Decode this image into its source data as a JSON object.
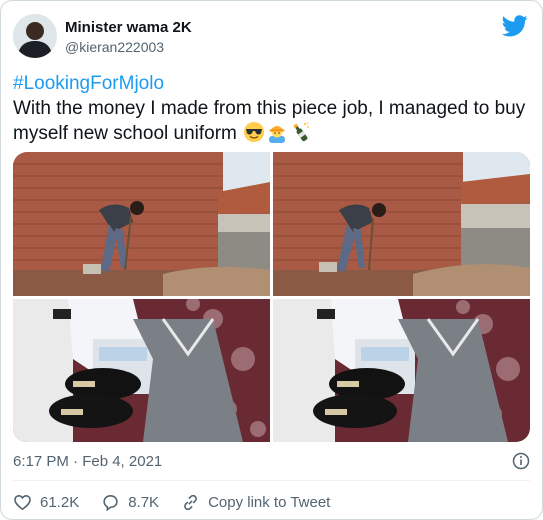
{
  "author": {
    "display_name": "Minister wama 2K",
    "handle": "@kieran222003"
  },
  "tweet": {
    "hashtag": "#LookingForMjolo",
    "text": "With the money I made from this piece job, I managed to buy myself new school uniform",
    "emojis": [
      "smiling-face-with-sunglasses",
      "construction-worker",
      "champagne-bottle"
    ]
  },
  "media": {
    "photos": [
      "photo-1",
      "photo-2",
      "photo-3",
      "photo-4"
    ]
  },
  "meta": {
    "timestamp": "6:17 PM · Feb 4, 2021"
  },
  "actions": {
    "likes": "61.2K",
    "replies": "8.7K",
    "copy_link": "Copy link to Tweet"
  },
  "colors": {
    "accent": "#1d9bf0",
    "like": "#536471",
    "muted": "#536471",
    "border": "#cfd9de"
  }
}
